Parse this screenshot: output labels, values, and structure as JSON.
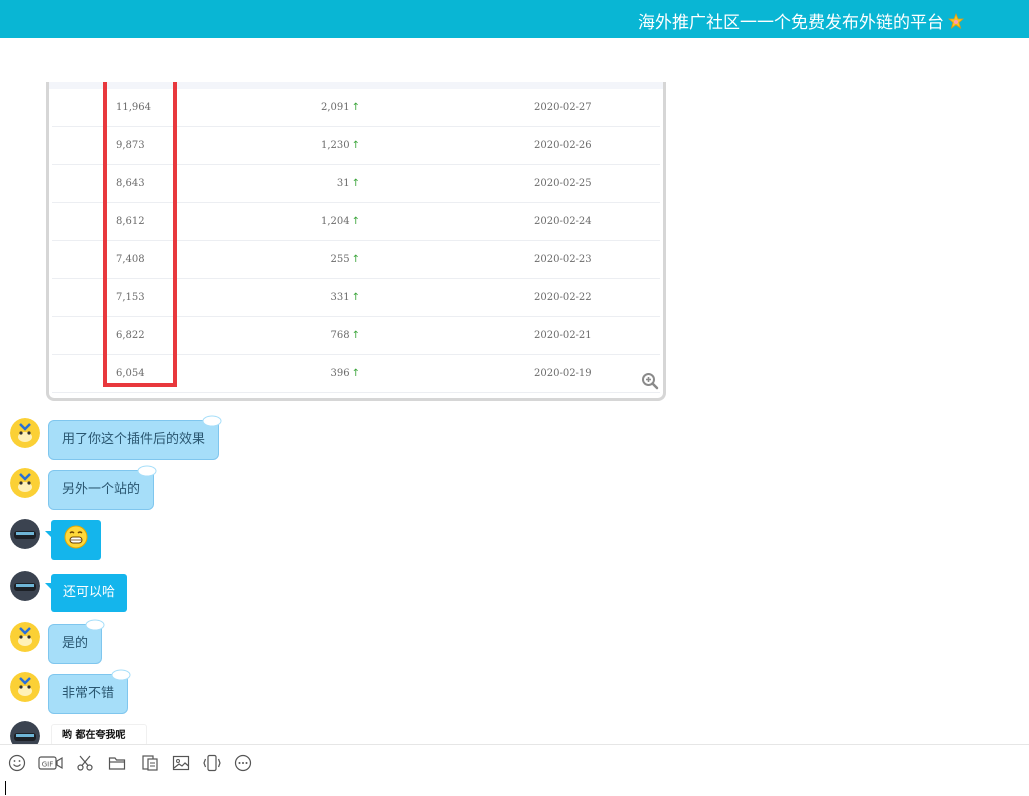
{
  "window": {
    "title": "海外推广社区一一个免费发布外链的平台",
    "title_icon": "star-icon"
  },
  "colors": {
    "titlebar": "#09b6d4",
    "bubble_light": "#a6def9",
    "bubble_blue": "#14b5ec",
    "highlight_box": "#e8383d",
    "arrow": "#3aa53a"
  },
  "screenshot_table": {
    "rows": [
      {
        "total": "11,964",
        "delta": "2,091",
        "date": "2020-02-27"
      },
      {
        "total": "9,873",
        "delta": "1,230",
        "date": "2020-02-26"
      },
      {
        "total": "8,643",
        "delta": "31",
        "date": "2020-02-25"
      },
      {
        "total": "8,612",
        "delta": "1,204",
        "date": "2020-02-24"
      },
      {
        "total": "7,408",
        "delta": "255",
        "date": "2020-02-23"
      },
      {
        "total": "7,153",
        "delta": "331",
        "date": "2020-02-22"
      },
      {
        "total": "6,822",
        "delta": "768",
        "date": "2020-02-21"
      },
      {
        "total": "6,054",
        "delta": "396",
        "date": "2020-02-19"
      }
    ],
    "arrow_glyph": "↑",
    "zoom_icon": "zoom-in-icon"
  },
  "messages": [
    {
      "sender": "other",
      "type": "text",
      "text": "用了你这个插件后的效果"
    },
    {
      "sender": "other",
      "type": "text",
      "text": "另外一个站的"
    },
    {
      "sender": "self",
      "type": "emoji",
      "emoji": "😁"
    },
    {
      "sender": "self",
      "type": "text",
      "text": "还可以哈"
    },
    {
      "sender": "other",
      "type": "text",
      "text": "是的"
    },
    {
      "sender": "other",
      "type": "text",
      "text": "非常不错"
    },
    {
      "sender": "self",
      "type": "sticker",
      "text": "哟 都在夸我呢"
    }
  ],
  "toolbar": {
    "items": [
      "emoji-icon",
      "gif-icon",
      "scissors-icon",
      "folder-icon",
      "screenshot-doc-icon",
      "image-icon",
      "shake-icon",
      "more-icon"
    ],
    "gif_label": "GIF"
  }
}
